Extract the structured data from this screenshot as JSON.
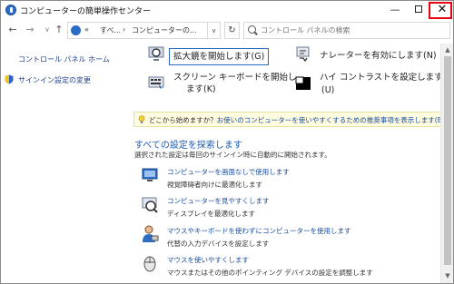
{
  "window": {
    "title": "コンピューターの簡単操作センター",
    "minimize_glyph": "—",
    "close_glyph": "✕",
    "highlight_color": "#e60012"
  },
  "nav": {
    "back_glyph": "←",
    "forward_glyph": "→",
    "dropdown_glyph": "∨",
    "up_glyph": "↑",
    "refresh_glyph": "↻"
  },
  "address": {
    "overflow": "«",
    "segment_1": "すべ...",
    "separator": "›",
    "segment_2": "コンピューターの...",
    "dropdown_glyph": "∨"
  },
  "search": {
    "placeholder": "コントロール パネルの検索"
  },
  "sidebar": {
    "home": "コントロール パネル ホーム",
    "signin": "サインイン設定の変更"
  },
  "quick_access": {
    "magnifier": "拡大鏡を開始します(G)",
    "narrator": "ナレーターを有効にします(N)",
    "keyboard_line1": "スクリーン キーボードを開始し",
    "keyboard_line2": "ます(K)",
    "contrast_line1": "ハイ コントラストを設定します",
    "contrast_line2": "(U)"
  },
  "tip": {
    "prefix": "どこから始めますか？",
    "link": "お使いのコンピューターを使いやすくするための推奨事項を表示します(E)"
  },
  "explore": {
    "title": "すべての設定を探索します",
    "subtitle": "選択された設定は毎回のサインイン時に自動的に開始されます。"
  },
  "settings_items": [
    {
      "link": "コンピューターを画面なしで使用します",
      "desc": "視覚障碍者向けに最適化します"
    },
    {
      "link": "コンピューターを見やすくします",
      "desc": "ディスプレイを最適化します"
    },
    {
      "link": "マウスやキーボードを使わずにコンピューターを使用します",
      "desc": "代替の入力デバイスを設定します"
    },
    {
      "link": "マウスを使いやすくします",
      "desc": "マウスまたはその他のポインティング デバイスの設定を調整します"
    }
  ],
  "scrollbar": {
    "up_glyph": "▲",
    "down_glyph": "▼"
  },
  "colors": {
    "link": "#1a4ea3",
    "section_title": "#1e5bb8",
    "tip_background": "#fdfbe0"
  }
}
